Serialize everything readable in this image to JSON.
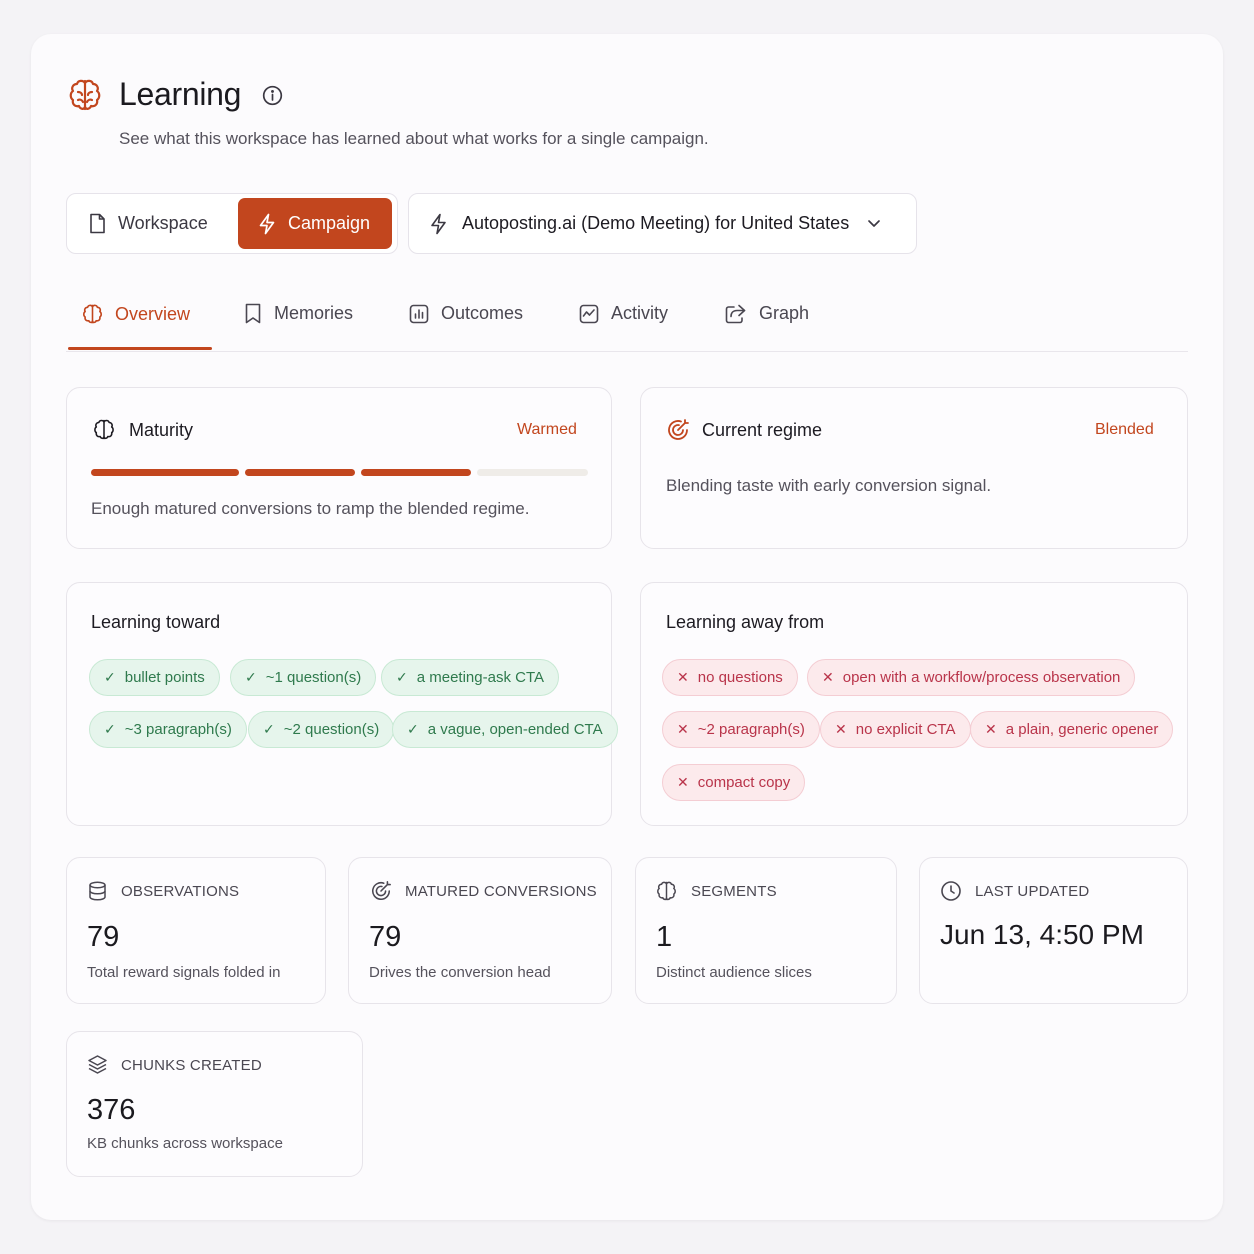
{
  "header": {
    "title": "Learning",
    "subtitle": "See what this workspace has learned about what works for a single campaign."
  },
  "scope": {
    "workspace_label": "Workspace",
    "campaign_label": "Campaign",
    "selected": "Campaign",
    "campaign_select_value": "Autoposting.ai (Demo Meeting) for United States"
  },
  "tabs": [
    {
      "label": "Overview",
      "icon": "brain-icon",
      "active": true
    },
    {
      "label": "Memories",
      "icon": "bookmark-icon",
      "active": false
    },
    {
      "label": "Outcomes",
      "icon": "bar-chart-icon",
      "active": false
    },
    {
      "label": "Activity",
      "icon": "activity-icon",
      "active": false
    },
    {
      "label": "Graph",
      "icon": "share-icon",
      "active": false
    }
  ],
  "maturity": {
    "title": "Maturity",
    "status": "Warmed",
    "level": 3,
    "level_max": 4,
    "description": "Enough matured conversions to ramp the blended regime."
  },
  "regime": {
    "title": "Current regime",
    "status": "Blended",
    "description": "Blending taste with early conversion signal."
  },
  "learning_toward": {
    "title": "Learning toward",
    "mark": "✓",
    "items": [
      "bullet points",
      "~1 question(s)",
      "a meeting-ask CTA",
      "~3 paragraph(s)",
      "~2 question(s)",
      "a vague, open-ended CTA"
    ]
  },
  "learning_away": {
    "title": "Learning away from",
    "mark": "✕",
    "items": [
      "no questions",
      "open with a workflow/process observation",
      "~2 paragraph(s)",
      "no explicit CTA",
      "a plain, generic opener",
      "compact copy"
    ]
  },
  "stats": {
    "observations": {
      "label": "OBSERVATIONS",
      "value": "79",
      "desc": "Total reward signals folded in"
    },
    "matured": {
      "label": "MATURED CONVERSIONS",
      "value": "79",
      "desc": "Drives the conversion head"
    },
    "segments": {
      "label": "SEGMENTS",
      "value": "1",
      "desc": "Distinct audience slices"
    },
    "updated": {
      "label": "LAST UPDATED",
      "value": "Jun 13, 4:50 PM"
    },
    "chunks": {
      "label": "CHUNKS CREATED",
      "value": "376",
      "desc": "KB chunks across workspace"
    }
  },
  "colors": {
    "accent": "#c2461e",
    "good": "#2f7a4d",
    "bad": "#b9344a",
    "bar_empty": "#efece8"
  }
}
